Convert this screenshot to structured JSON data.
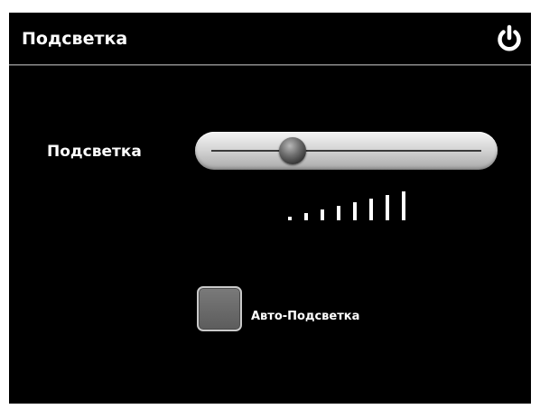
{
  "header": {
    "title": "Подсветка",
    "power_icon": "power-icon"
  },
  "brightness": {
    "label": "Подсветка",
    "level_fraction": 0.3,
    "meter_bars": 8
  },
  "auto_backlight": {
    "label": "Авто-Подсветка",
    "checked": false
  },
  "colors": {
    "background": "#000000",
    "text": "#ffffff",
    "slider": "#d6d6d6",
    "knob": "#555555",
    "checkbox": "#6a6a6a"
  }
}
